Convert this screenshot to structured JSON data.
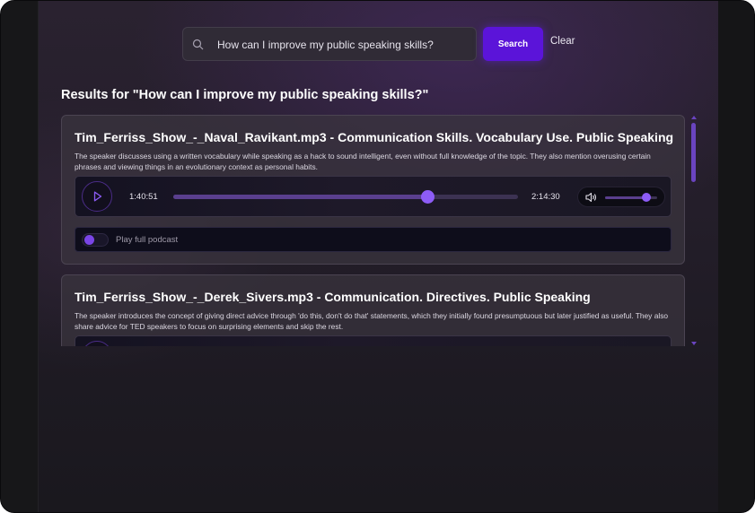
{
  "search": {
    "query": "How can I improve my public speaking skills?",
    "search_label": "Search",
    "clear_label": "Clear"
  },
  "results_heading": "Results for \"How can I improve my public speaking skills?\"",
  "results": [
    {
      "title": "Tim_Ferriss_Show_-_Naval_Ravikant.mp3 - Communication Skills. Vocabulary Use. Public Speaking",
      "summary": "The speaker discusses using a written vocabulary while speaking as a hack to sound intelligent, even without full knowledge of the topic. They also mention overusing certain phrases and viewing things in an evolutionary context as personal habits.",
      "player": {
        "current_time": "1:40:51",
        "total_time": "2:14:30",
        "progress": 0.738,
        "volume": 0.8
      },
      "full_podcast_label": "Play full podcast"
    },
    {
      "title": "Tim_Ferriss_Show_-_Derek_Sivers.mp3 - Communication. Directives. Public Speaking",
      "summary": "The speaker introduces the concept of giving direct advice through 'do this, don't do that' statements, which they initially found presumptuous but later justified as useful. They also share advice for TED speakers to focus on surprising elements and skip the rest."
    }
  ],
  "icons": {
    "search": "magnifier-icon",
    "play": "play-icon",
    "volume": "speaker-icon"
  },
  "colors": {
    "accent": "#5b14d9",
    "slider_thumb": "#8d5cf6"
  }
}
